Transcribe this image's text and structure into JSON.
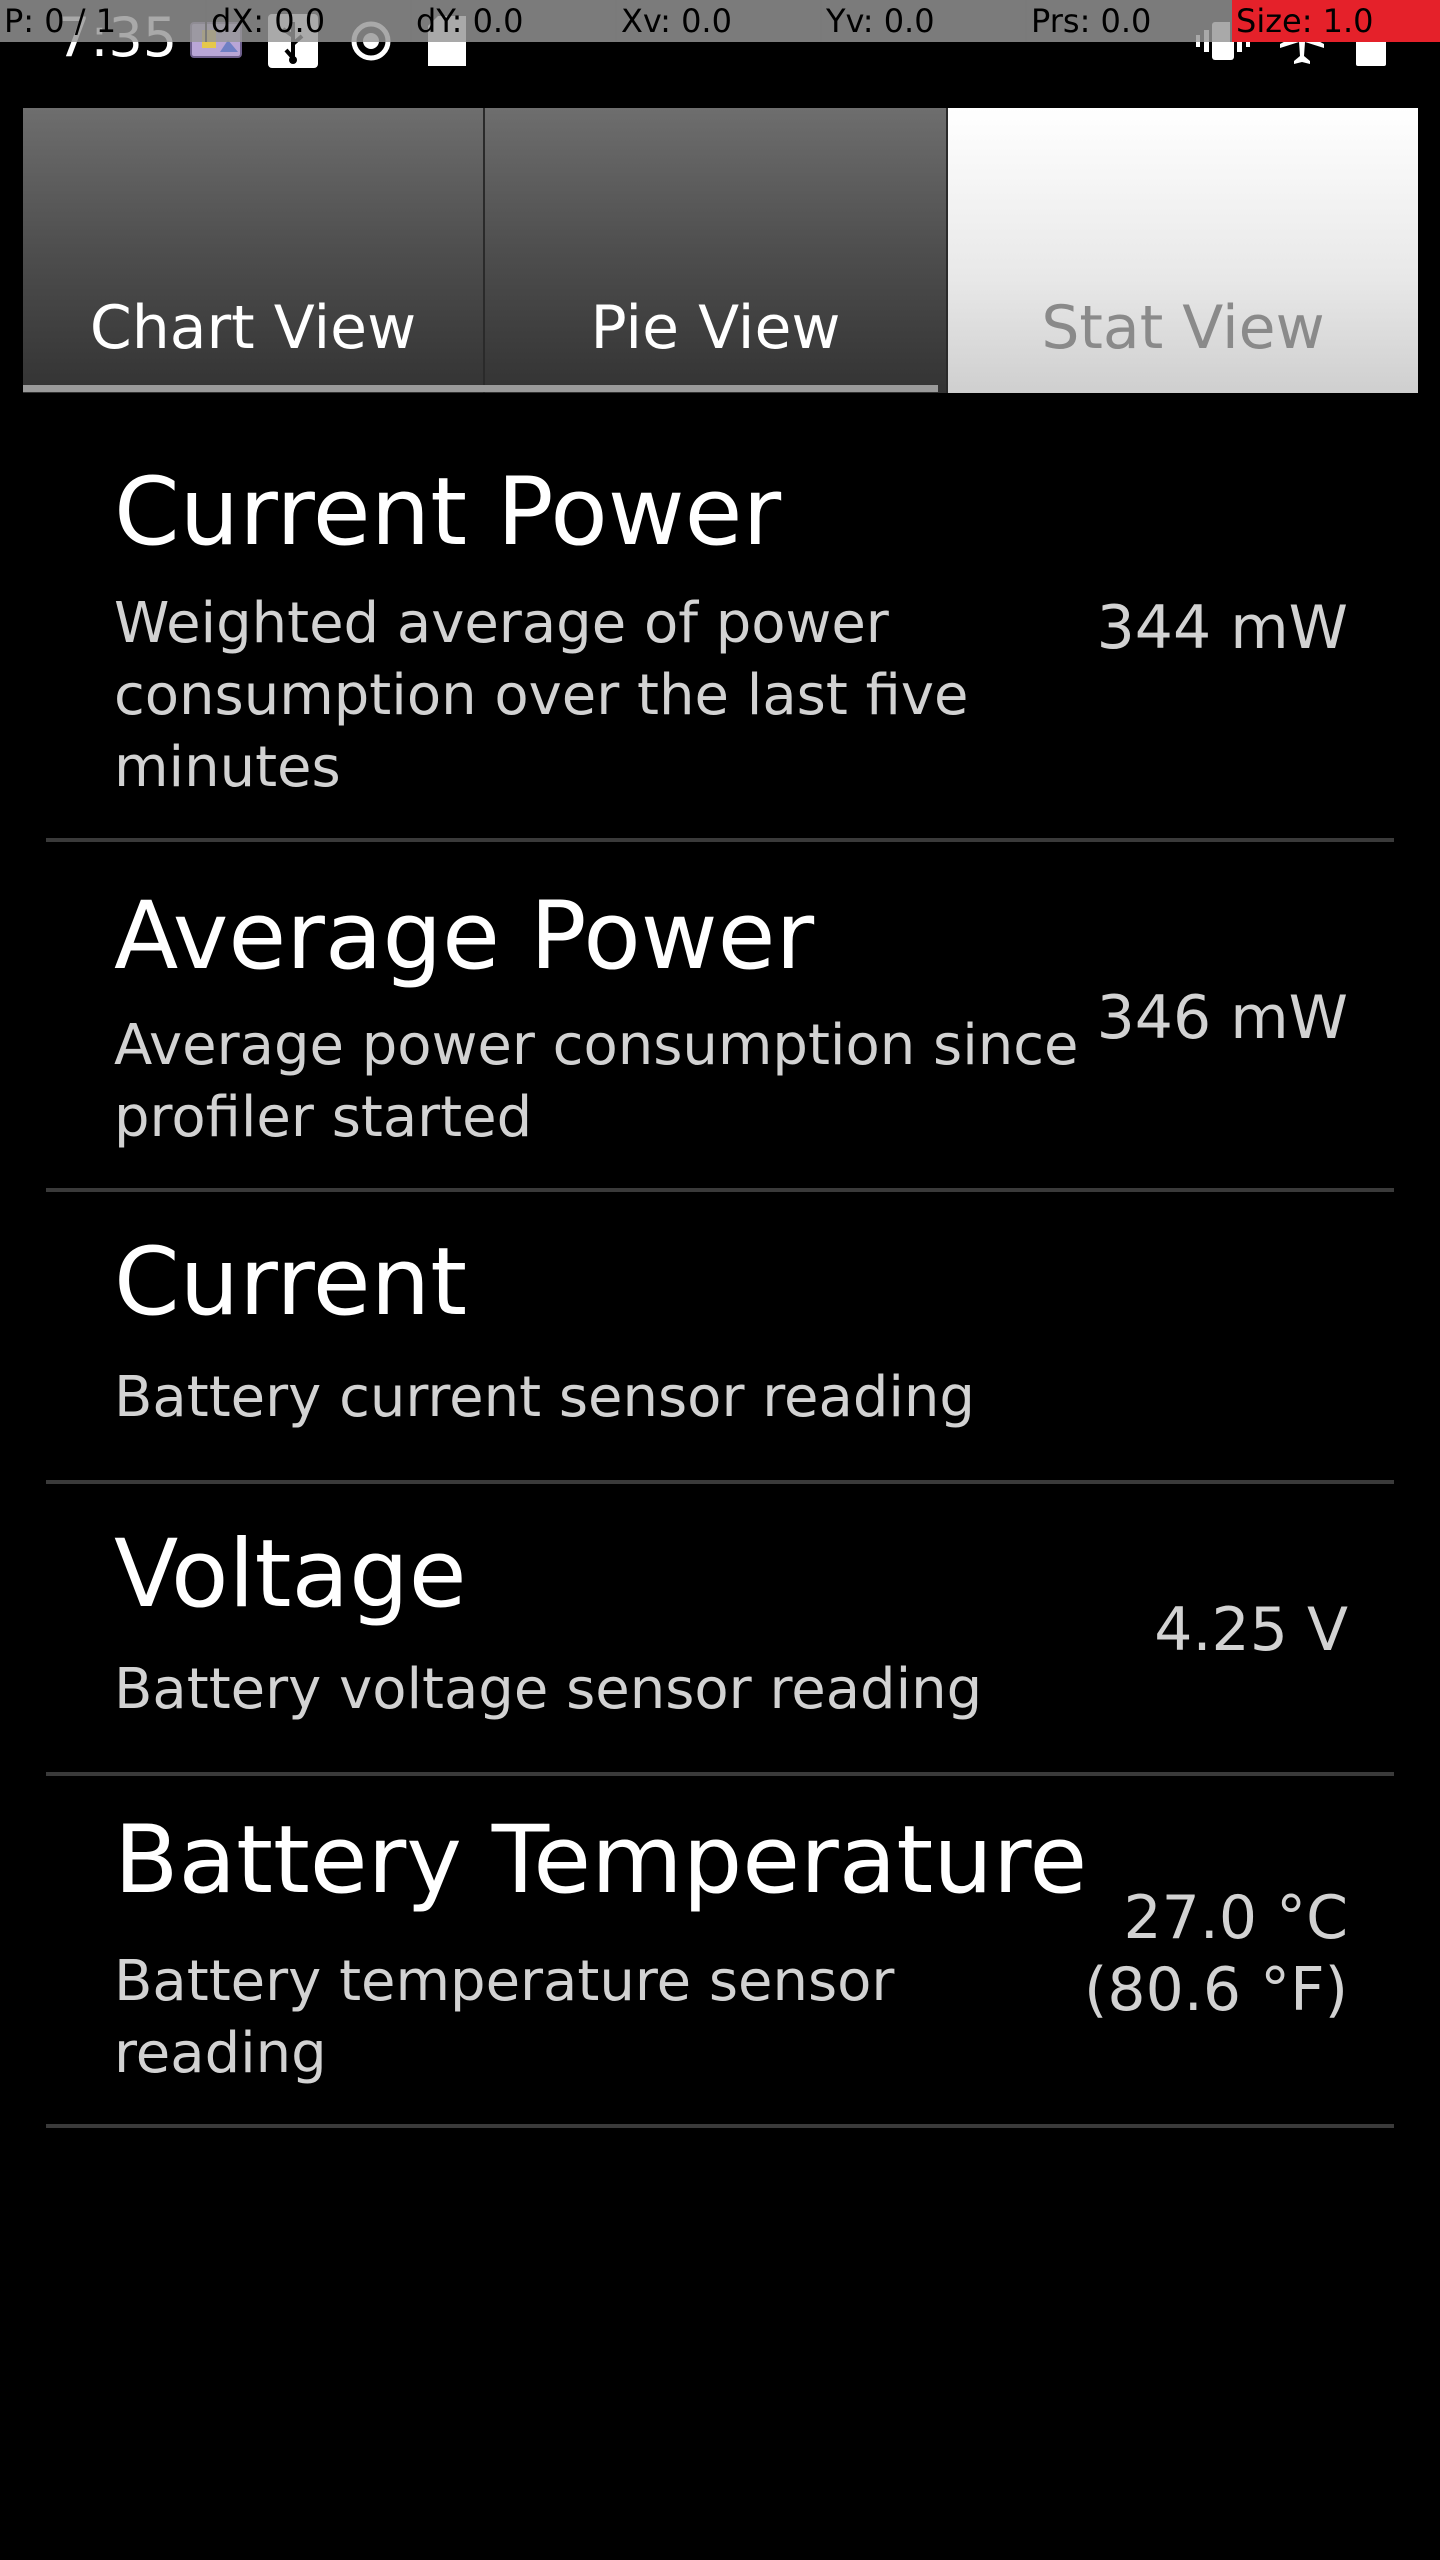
{
  "status_bar": {
    "time": "7:35",
    "left_icons": [
      "photo-icon",
      "usb-icon",
      "location-icon",
      "sd-card-icon"
    ],
    "right_icons": [
      "vibrate-icon",
      "airplane-mode-icon",
      "battery-icon"
    ]
  },
  "pointer_overlay": {
    "pointers": "P: 0 / 1",
    "dx": "dX: 0.0",
    "dy": "dY: 0.0",
    "xv": "Xv: 0.0",
    "yv": "Yv: 0.0",
    "prs": "Prs: 0.0",
    "size": "Size: 1.0",
    "alert_color": "#e5212a"
  },
  "tabs": [
    {
      "label": "Chart View",
      "active": false
    },
    {
      "label": "Pie View",
      "active": false
    },
    {
      "label": "Stat View",
      "active": true
    }
  ],
  "stats": [
    {
      "title": "Current Power",
      "description": "Weighted average of power consumption over the last five minutes",
      "value": "344 mW"
    },
    {
      "title": "Average Power",
      "description": "Average power consumption since profiler started",
      "value": "346 mW"
    },
    {
      "title": "Current",
      "description": "Battery current sensor reading",
      "value": ""
    },
    {
      "title": "Voltage",
      "description": "Battery voltage sensor reading",
      "value": "4.25 V"
    },
    {
      "title": "Battery Temperature",
      "description": "Battery temperature sensor reading",
      "value_line1": "27.0 °C",
      "value_line2": "(80.6 °F)"
    }
  ]
}
